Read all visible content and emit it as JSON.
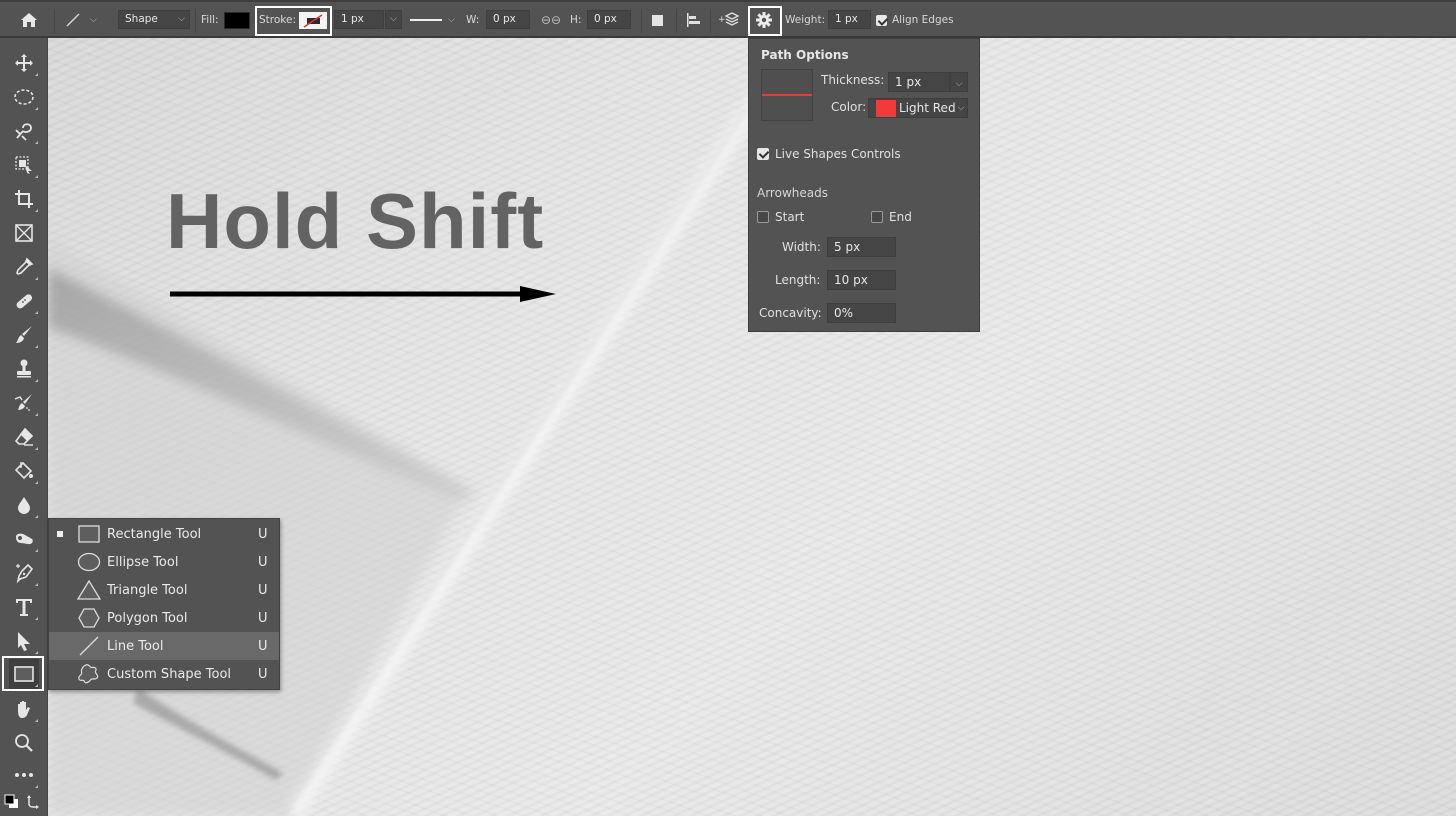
{
  "options_bar": {
    "home_icon": "home-icon",
    "tool_preset_icon": "line-tool-icon",
    "mode_select": "Shape",
    "fill_label": "Fill:",
    "fill_color": "#000000",
    "stroke_label": "Stroke:",
    "stroke_width": "1 px",
    "stroke_style": "solid-line",
    "w_label": "W:",
    "w_value": "0 px",
    "link_icon": "link-icon",
    "h_label": "H:",
    "h_value": "0 px",
    "path_operations_icon": "path-operations-icon",
    "path_alignment_icon": "path-alignment-icon",
    "path_arrangement_icon": "path-arrangement-icon",
    "settings_icon": "gear-icon",
    "weight_label": "Weight:",
    "weight_value": "1 px",
    "align_edges_label": "Align Edges",
    "align_edges_checked": true
  },
  "path_options": {
    "title": "Path Options",
    "thickness_label": "Thickness:",
    "thickness_value": "1 px",
    "color_label": "Color:",
    "color_value": "Light Red",
    "color_swatch": "#f23a3a",
    "live_shapes_label": "Live Shapes Controls",
    "live_shapes_checked": true,
    "arrowheads_label": "Arrowheads",
    "start_label": "Start",
    "start_checked": false,
    "end_label": "End",
    "end_checked": false,
    "width_label": "Width:",
    "width_value": "5 px",
    "length_label": "Length:",
    "length_value": "10 px",
    "concavity_label": "Concavity:",
    "concavity_value": "0%"
  },
  "canvas": {
    "overlay_text": "Hold Shift"
  },
  "toolbar": {
    "tools": [
      "move",
      "elliptical-marquee",
      "object-selection",
      "frame-select",
      "crop",
      "frame",
      "eyedropper",
      "healing-brush",
      "brush",
      "clone-stamp",
      "history-brush",
      "eraser",
      "paint-bucket",
      "blur",
      "dodge",
      "pen",
      "type",
      "path-selection",
      "rectangle",
      "hand",
      "zoom",
      "edit-toolbar",
      "swap-colors"
    ],
    "active_tool": "rectangle"
  },
  "flyout": {
    "items": [
      {
        "label": "Rectangle Tool",
        "shortcut": "U",
        "icon": "rectangle-icon",
        "current": true
      },
      {
        "label": "Ellipse Tool",
        "shortcut": "U",
        "icon": "ellipse-icon"
      },
      {
        "label": "Triangle Tool",
        "shortcut": "U",
        "icon": "triangle-icon"
      },
      {
        "label": "Polygon Tool",
        "shortcut": "U",
        "icon": "polygon-icon"
      },
      {
        "label": "Line Tool",
        "shortcut": "U",
        "icon": "line-icon",
        "hovered": true
      },
      {
        "label": "Custom Shape Tool",
        "shortcut": "U",
        "icon": "custom-shape-icon"
      }
    ]
  }
}
